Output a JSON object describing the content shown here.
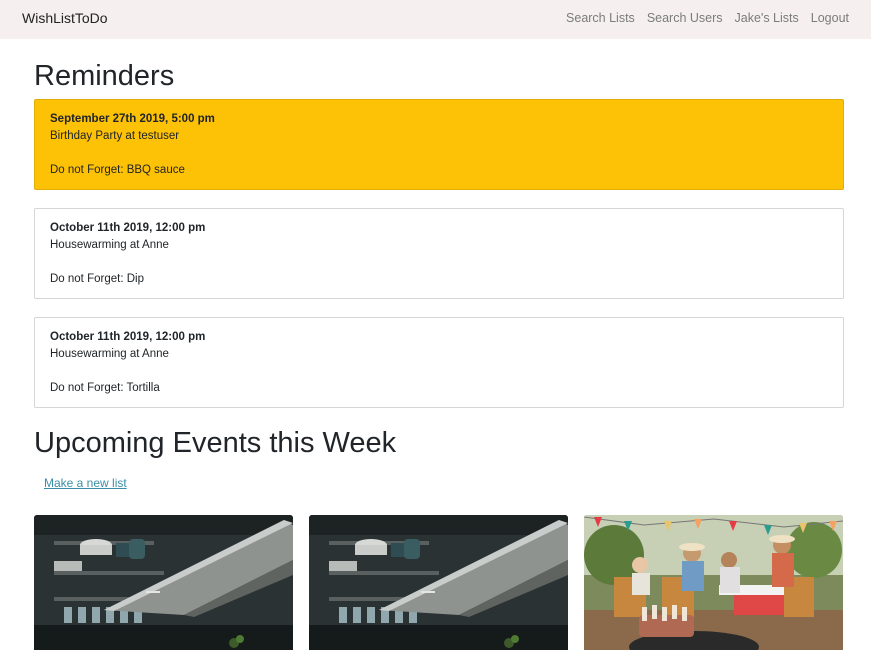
{
  "navbar": {
    "brand": "WishListToDo",
    "links": [
      "Search Lists",
      "Search Users",
      "Jake's Lists",
      "Logout"
    ]
  },
  "reminders": {
    "title": "Reminders",
    "items": [
      {
        "date": "September 27th 2019, 5:00 pm",
        "event": "Birthday Party at testuser",
        "forget": "Do not Forget: BBQ sauce",
        "highlight_color": "#fdc105"
      },
      {
        "date": "October 11th 2019, 12:00 pm",
        "event": "Housewarming at Anne",
        "forget": "Do not Forget: Dip"
      },
      {
        "date": "October 11th 2019, 12:00 pm",
        "event": "Housewarming at Anne",
        "forget": "Do not Forget: Tortilla"
      }
    ]
  },
  "events": {
    "title": "Upcoming Events this Week",
    "new_list_link": "Make a new list",
    "cards": [
      {
        "image": "kitchen-range-hood-photo"
      },
      {
        "image": "kitchen-range-hood-photo"
      },
      {
        "image": "outdoor-bbq-party-photo"
      }
    ]
  }
}
